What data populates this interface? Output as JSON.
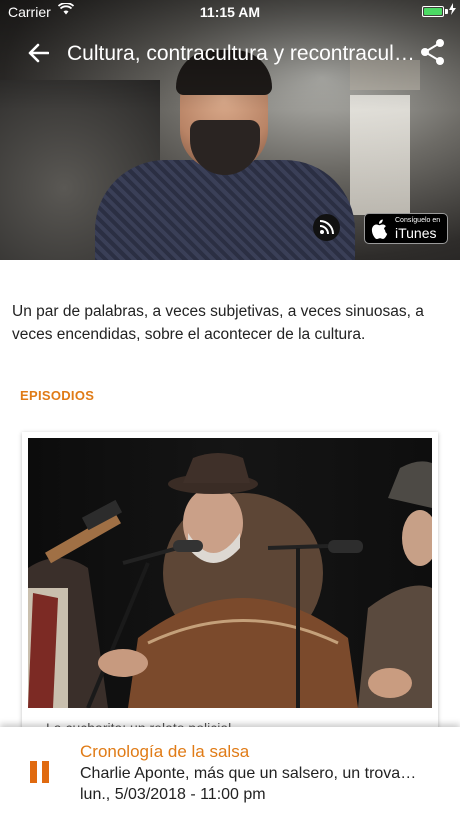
{
  "status_bar": {
    "carrier": "Carrier",
    "time": "11:15 AM",
    "battery_level": 1.0,
    "battery_color": "#4cd964"
  },
  "header": {
    "back_icon": "arrow-left-icon",
    "title": "Cultura, contracultura y recontracultura",
    "share_icon": "share-icon",
    "rss_icon": "rss-icon",
    "itunes_badge": {
      "small_text": "Consíguelo en",
      "big_text": "iTunes"
    }
  },
  "podcast": {
    "description": "Un par de palabras, a veces subjetivas, a veces sinuosas, a veces encendidas, sobre el acontecer de la cultura.",
    "section_label": "EPISODIOS",
    "accent_color": "#e07b16"
  },
  "episodes": [
    {
      "title": "La cucharita: un relato policial"
    }
  ],
  "player": {
    "control_icon": "pause-icon",
    "program": "Cronología de la salsa",
    "episode": "Charlie Aponte, más que un salsero, un trovador",
    "date": "lun., 5/03/2018 - 11:00 pm"
  }
}
